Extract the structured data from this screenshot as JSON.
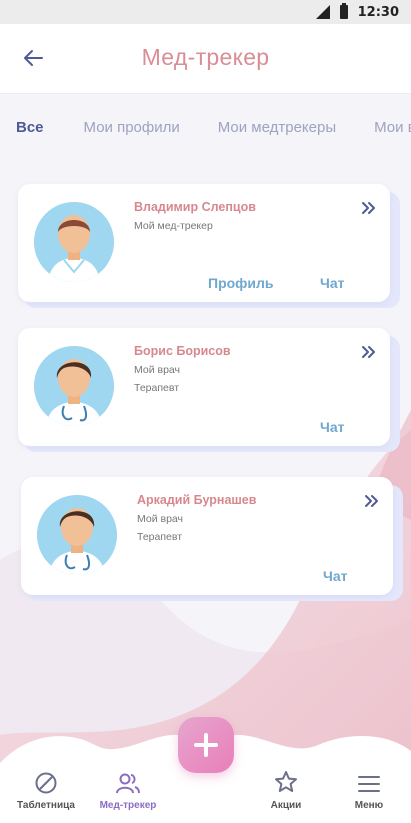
{
  "status_bar": {
    "time": "12:30"
  },
  "header": {
    "title": "Мед-трекер"
  },
  "tabs": [
    {
      "label": "Все"
    },
    {
      "label": "Мои профили"
    },
    {
      "label": "Мои медтрекеры"
    },
    {
      "label": "Мои в"
    }
  ],
  "cards": [
    {
      "name": "Владимир Слепцов",
      "lines": [
        "Мой мед-трекер"
      ],
      "actions": [
        "Профиль",
        "Чат"
      ]
    },
    {
      "name": "Борис Борисов",
      "lines": [
        "Мой врач",
        "Терапевт"
      ],
      "actions": [
        "Чат"
      ]
    },
    {
      "name": "Аркадий Бурнашев",
      "lines": [
        "Мой врач",
        "Терапевт"
      ],
      "actions": [
        "Чат"
      ]
    }
  ],
  "bottom_nav": {
    "items": [
      {
        "label": "Таблетница",
        "icon": "pill-icon"
      },
      {
        "label": "Мед-трекер",
        "icon": "people-icon",
        "active": true
      },
      {
        "label": "Акции",
        "icon": "star-icon"
      },
      {
        "label": "Меню",
        "icon": "menu-icon"
      }
    ],
    "fab_icon": "plus-icon"
  },
  "colors": {
    "title": "#d98e96",
    "name": "#d7888f",
    "link": "#6fa8cf",
    "tab_active": "#4f5a96",
    "nav_active": "#8b6cc2",
    "fab": "#e97fb9"
  }
}
